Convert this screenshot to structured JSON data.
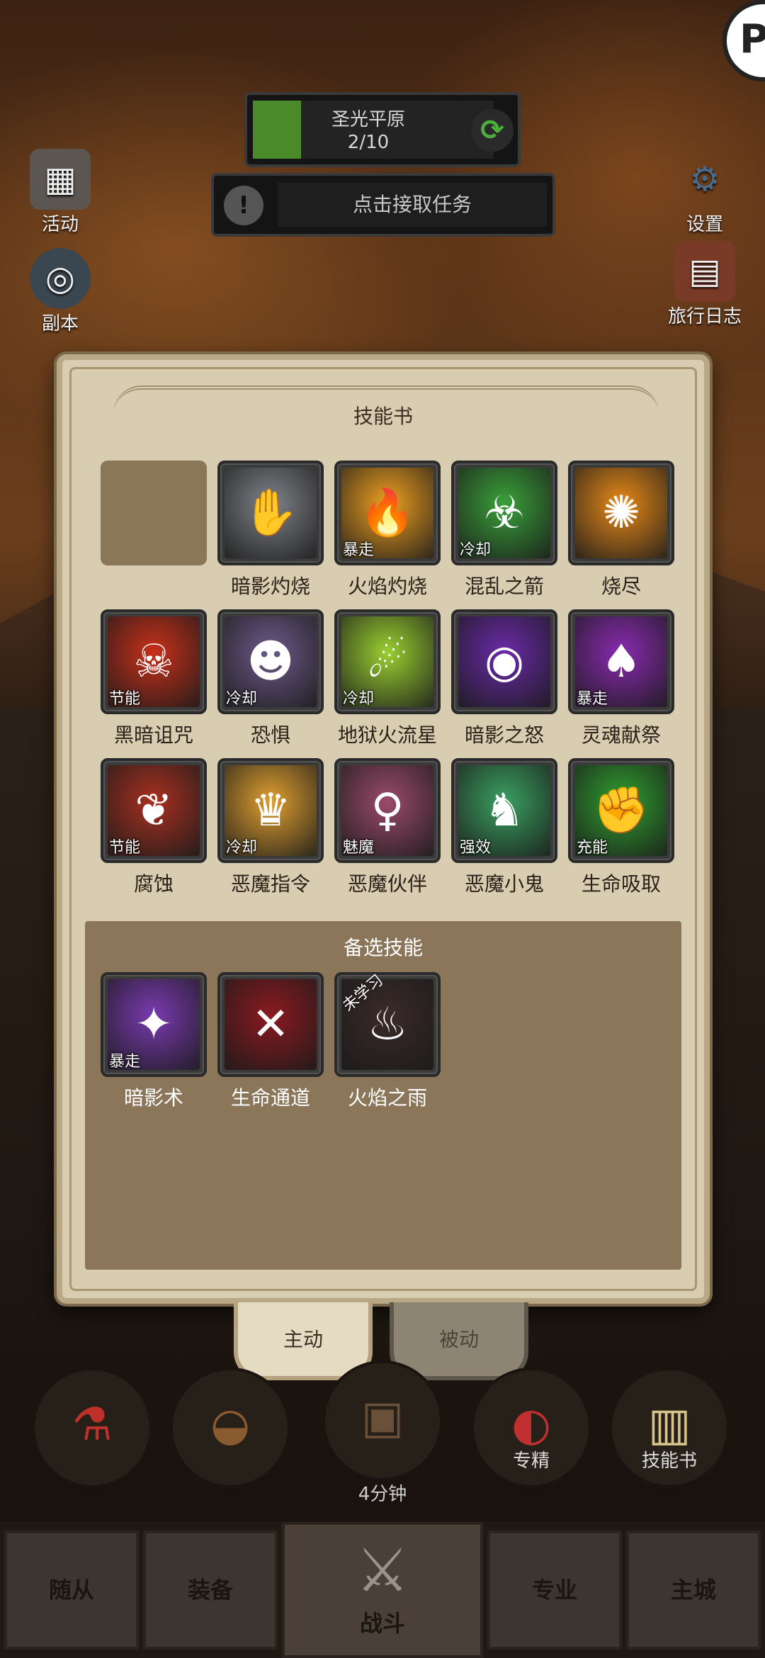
{
  "hud": {
    "zone_name": "圣光平原",
    "zone_progress": "2/10",
    "zone_progress_fraction": 0.2,
    "quest_text": "点击接取任务",
    "quest_alert": "!",
    "corner_badge": "P"
  },
  "side_left": [
    {
      "label": "活动",
      "icon": "calendar-icon"
    },
    {
      "label": "副本",
      "icon": "dungeon-portal-icon"
    }
  ],
  "side_right": [
    {
      "label": "设置",
      "icon": "gear-icon"
    },
    {
      "label": "旅行日志",
      "icon": "journal-icon"
    }
  ],
  "panel": {
    "title": "技能书",
    "equipped": [
      {
        "name": "",
        "tag": "",
        "icon": "empty-slot",
        "color": "#8a7758"
      },
      {
        "name": "暗影灼烧",
        "tag": "",
        "icon": "shadow-burn-icon",
        "color": "#7f8389"
      },
      {
        "name": "火焰灼烧",
        "tag": "暴走",
        "icon": "flame-burn-icon",
        "color": "#f0a020"
      },
      {
        "name": "混乱之箭",
        "tag": "冷却",
        "icon": "chaos-bolt-icon",
        "color": "#3aa03a"
      },
      {
        "name": "烧尽",
        "tag": "",
        "icon": "incinerate-icon",
        "color": "#e88a18"
      },
      {
        "name": "黑暗诅咒",
        "tag": "节能",
        "icon": "dark-curse-icon",
        "color": "#c8301a"
      },
      {
        "name": "恐惧",
        "tag": "冷却",
        "icon": "fear-icon",
        "color": "#6d5a8a"
      },
      {
        "name": "地狱火流星",
        "tag": "冷却",
        "icon": "infernal-meteor-icon",
        "color": "#9ad030"
      },
      {
        "name": "暗影之怒",
        "tag": "",
        "icon": "shadow-fury-icon",
        "color": "#6a2aa8"
      },
      {
        "name": "灵魂献祭",
        "tag": "暴走",
        "icon": "soul-sacrifice-icon",
        "color": "#8a2ab0"
      },
      {
        "name": "腐蚀",
        "tag": "节能",
        "icon": "corruption-icon",
        "color": "#a83020"
      },
      {
        "name": "恶魔指令",
        "tag": "冷却",
        "icon": "demon-command-icon",
        "color": "#e0a030"
      },
      {
        "name": "恶魔伙伴",
        "tag": "魅魔",
        "icon": "demon-companion-icon",
        "color": "#9a4a6a"
      },
      {
        "name": "恶魔小鬼",
        "tag": "强效",
        "icon": "imp-icon",
        "color": "#3aa060"
      },
      {
        "name": "生命吸取",
        "tag": "充能",
        "icon": "drain-life-icon",
        "color": "#30a030"
      }
    ],
    "alt_title": "备选技能",
    "alternates": [
      {
        "name": "暗影术",
        "tag": "暴走",
        "icon": "shadow-bolt-icon",
        "color": "#7a3ab0",
        "overlay": ""
      },
      {
        "name": "生命通道",
        "tag": "",
        "icon": "life-tap-icon",
        "color": "#8a1a20",
        "overlay": ""
      },
      {
        "name": "火焰之雨",
        "tag": "",
        "icon": "rain-of-fire-icon",
        "color": "#3a2a28",
        "overlay": "未学习"
      }
    ]
  },
  "tabs": {
    "active": "主动",
    "passive": "被动"
  },
  "actions": [
    {
      "label": "",
      "icon": "potion-icon"
    },
    {
      "label": "",
      "icon": "bread-icon"
    },
    {
      "label": "",
      "icon": "treasure-chest-icon"
    },
    {
      "label": "专精",
      "icon": "specialization-icon"
    },
    {
      "label": "技能书",
      "icon": "skill-book-icon"
    }
  ],
  "timer": "4分钟",
  "nav": {
    "followers": "随从",
    "equipment": "装备",
    "battle": "战斗",
    "profession": "专业",
    "main_city": "主城"
  }
}
